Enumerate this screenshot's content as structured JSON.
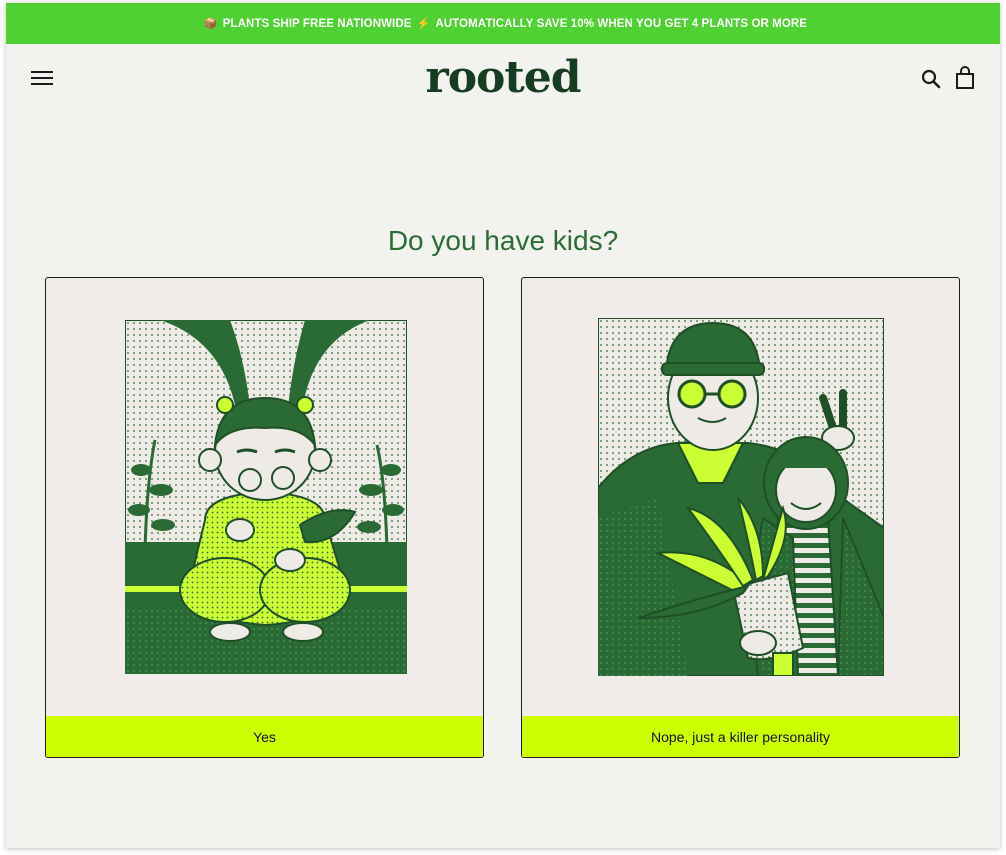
{
  "announcement": {
    "part1": "PLANTS SHIP FREE NATIONWIDE",
    "part2": "AUTOMATICALLY SAVE 10% WHEN YOU GET 4 PLANTS OR MORE",
    "icon_left": "package-icon",
    "icon_mid": "lightning-icon"
  },
  "header": {
    "logo": "rooted",
    "menu_icon": "hamburger-menu-icon",
    "search_icon": "search-icon",
    "cart_icon": "shopping-bag-icon"
  },
  "quiz": {
    "question": "Do you have kids?",
    "options": [
      {
        "label": "Yes",
        "illustration": "girl-with-plants-illustration"
      },
      {
        "label": "Nope, just a killer personality",
        "illustration": "man-and-girl-with-plant-illustration"
      }
    ]
  },
  "colors": {
    "announcement_bg": "#4fd133",
    "brand_green": "#163d22",
    "question_text": "#2c6b35",
    "cta_bg": "#ccff00",
    "illustration_dark": "#2a6a35",
    "illustration_lime": "#ccff33"
  }
}
